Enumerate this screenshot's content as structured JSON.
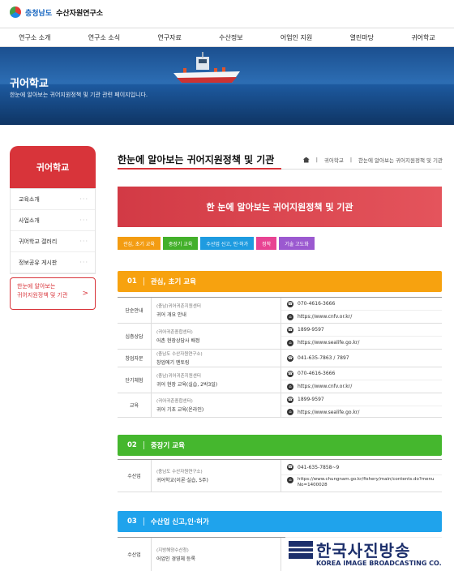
{
  "header": {
    "org": "충청남도",
    "name": "수산자원연구소",
    "nav": [
      "연구소 소개",
      "연구소 소식",
      "연구자료",
      "수산정보",
      "어업인 지원",
      "열린마당",
      "귀어학교"
    ]
  },
  "banner": {
    "title": "귀어학교",
    "subtitle": "한눈에 알아보는 귀어지원정책 및 기관 관련 페이지입니다."
  },
  "sidebar": {
    "title": "귀어학교",
    "items": [
      {
        "label": "교육소개"
      },
      {
        "label": "사업소개"
      },
      {
        "label": "귀어학교 갤러리"
      },
      {
        "label": "정보공유 게시판"
      }
    ],
    "active_line1": "한눈에 알아보는",
    "active_line2": "귀어지원정책 및 기관",
    "arrow": ">"
  },
  "content": {
    "title": "한눈에 알아보는 귀어지원정책 및 기관",
    "breadcrumb": [
      "귀어학교",
      "한눈에 알아보는 귀어지원정책 및 기관"
    ],
    "banner_text": "한 눈에 알아보는 귀어지원정책 및 기관",
    "chips": [
      {
        "label": "관심, 초기 교육",
        "color": "#f39c12"
      },
      {
        "label": "중장기 교육",
        "color": "#43b02a"
      },
      {
        "label": "수산업 신고, 인·허가",
        "color": "#1e9be0"
      },
      {
        "label": "정착",
        "color": "#e84393"
      },
      {
        "label": "기술 고도화",
        "color": "#9b59d0"
      }
    ]
  },
  "sections": [
    {
      "num": "01",
      "title": "관심, 초기 교육",
      "color": "#f7a20f",
      "rows": [
        {
          "cat": "단순안내",
          "org": "(충남)귀어귀촌지원센터",
          "prog": "귀어 개요 안내",
          "tel": "070-4616-3666",
          "url": "https://www.cnfv.or.kr/"
        },
        {
          "cat": "심층상담",
          "org": "(귀어귀촌종합센터)",
          "prog": "어촌 현장상담사 배정",
          "tel": "1899-9597",
          "url": "https://www.sealife.go.kr/"
        },
        {
          "cat": "창업자문",
          "org": "(충남도 수산자원연구소)",
          "prog": "창업에기 멘토링",
          "tel": "041-635-7863 / 7897",
          "url": ""
        },
        {
          "cat": "단기체험",
          "org": "(충남)귀어귀촌지원센터",
          "prog": "귀어 현장 교육(실습, 2박3일)",
          "tel": "070-4616-3666",
          "url": "https://www.cnfv.or.kr/"
        },
        {
          "cat": "교육",
          "org": "(귀어귀촌종합센터)",
          "prog": "귀어 기초 교육(온라인)",
          "tel": "1899-9597",
          "url": "https://www.sealife.go.kr/"
        }
      ]
    },
    {
      "num": "02",
      "title": "중장기 교육",
      "color": "#45b72e",
      "rows": [
        {
          "cat": "수산업",
          "org": "(충남도 수산자원연구소)",
          "prog": "귀어학교(이론·실습, 5주)",
          "tel": "041-635-7858~9",
          "url": "https://www.chungnam.go.kr/fishery/main/contents.do?menuNo=1400028"
        }
      ]
    },
    {
      "num": "03",
      "title": "수산업 신고,인·허가",
      "color": "#1fa3ec",
      "rows": [
        {
          "cat": "수산업",
          "org": "(지방해양수산청)",
          "prog": "어업인 경영체 등록",
          "tel": "",
          "url": ""
        }
      ]
    }
  ],
  "watermark": {
    "ko": "한국사진방송",
    "en": "KOREA IMAGE BROADCASTING CO."
  }
}
